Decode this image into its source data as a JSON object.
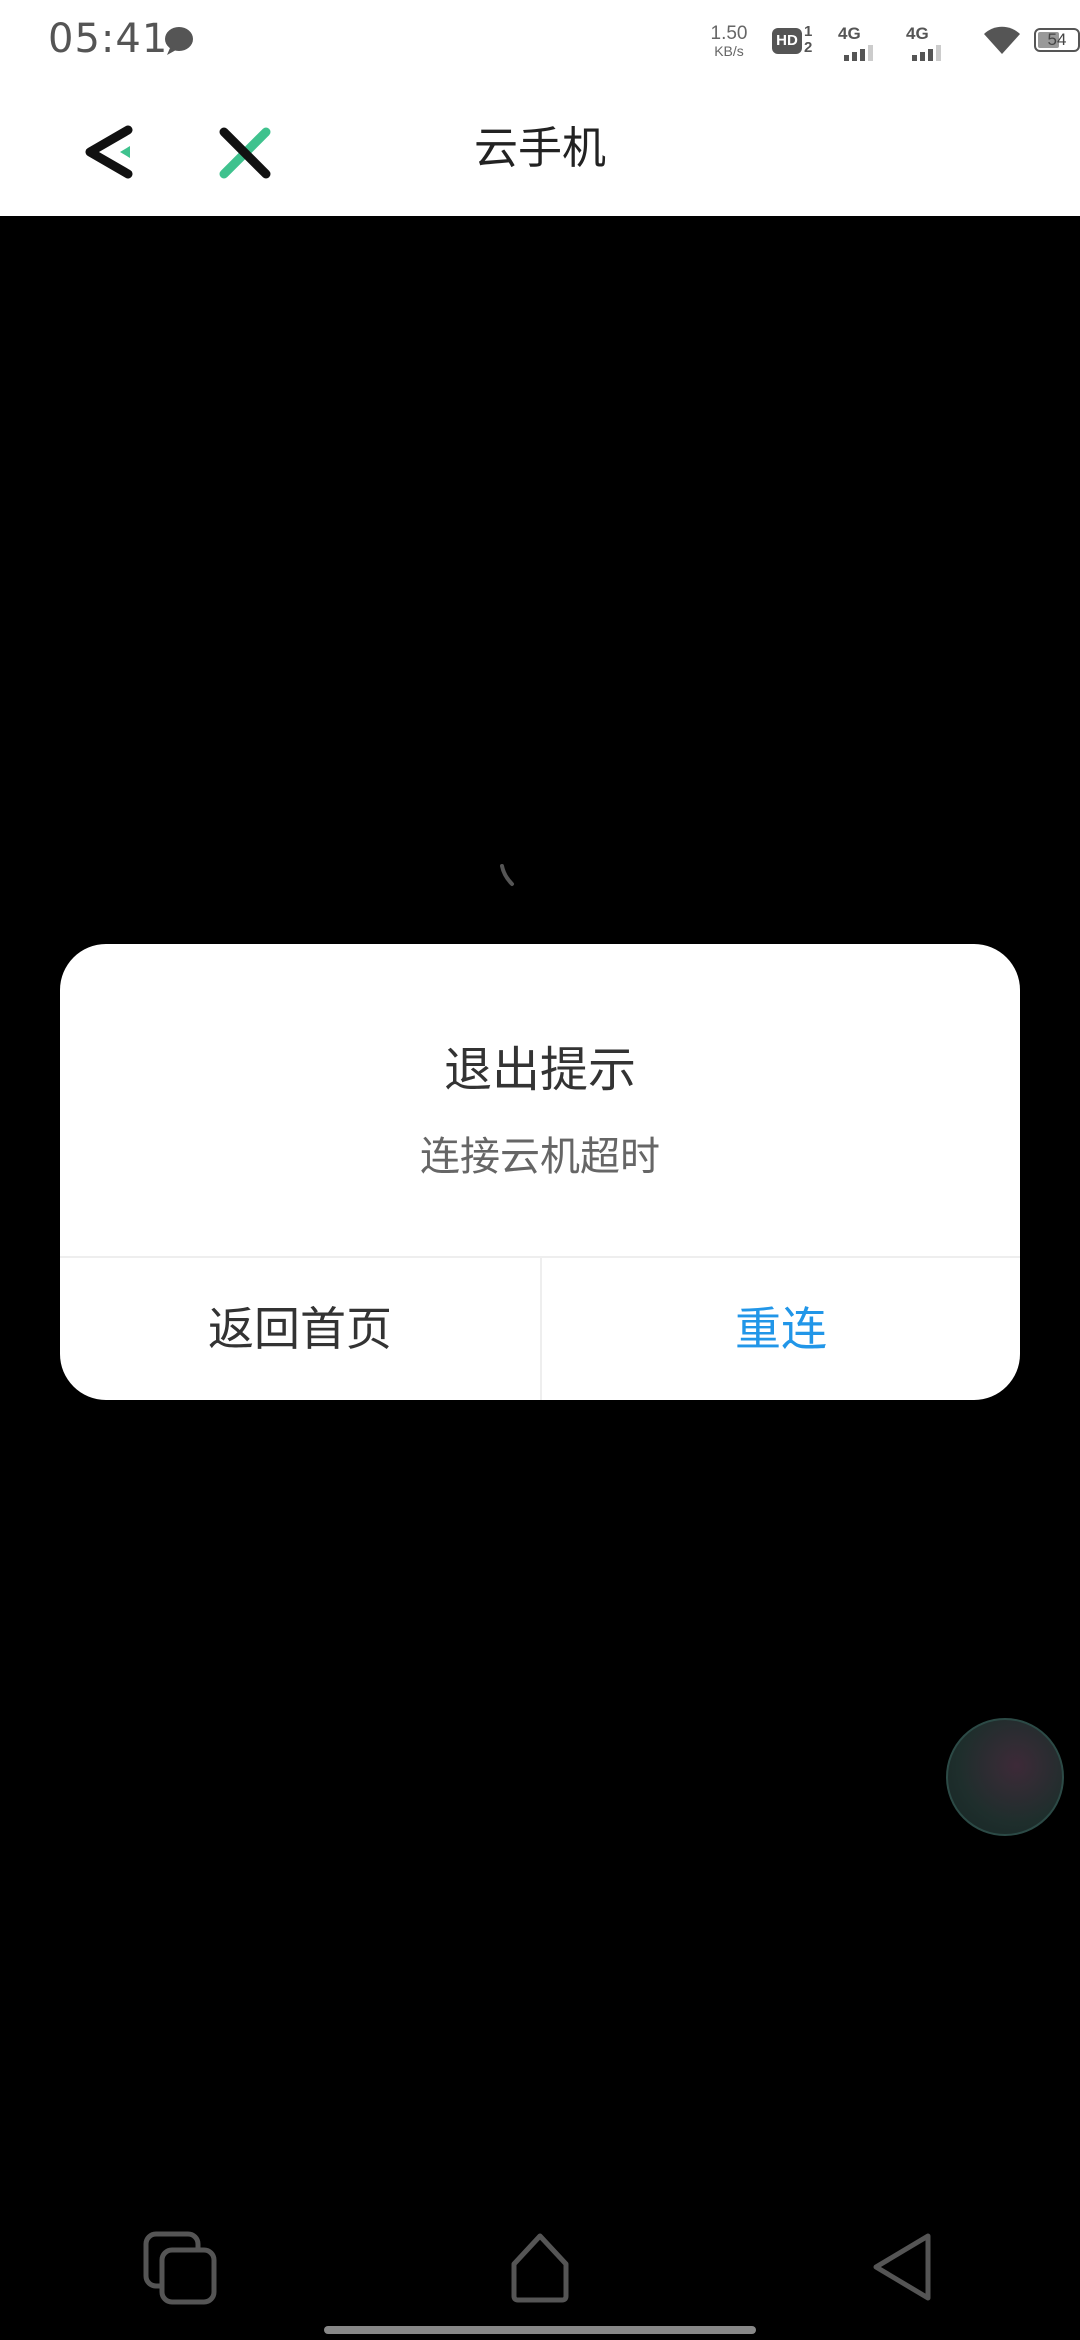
{
  "status_bar": {
    "time": "05:41",
    "net_speed_value": "1.50",
    "net_speed_unit": "KB/s",
    "hd_badge": "HD",
    "hd_sim_top": "1",
    "hd_sim_bottom": "2",
    "sim1_network": "4G",
    "sim2_network": "4G",
    "battery_level": "54",
    "battery_fraction": 0.54,
    "icons": [
      "message-icon",
      "hd-voice-icon",
      "signal-icon",
      "wifi-icon",
      "battery-icon"
    ]
  },
  "title_bar": {
    "title": "云手机",
    "back_icon": "back-chevron-icon",
    "close_icon": "close-icon"
  },
  "dialog": {
    "title": "退出提示",
    "message": "连接云机超时",
    "home_button_label": "返回首页",
    "reconnect_button_label": "重连"
  },
  "nav_bar": {
    "icons": [
      "recent-apps-icon",
      "home-icon",
      "back-triangle-icon"
    ]
  },
  "colors": {
    "accent_green": "#3fc28e",
    "accent_blue": "#2196e8",
    "background": "#000000",
    "surface": "#ffffff"
  }
}
